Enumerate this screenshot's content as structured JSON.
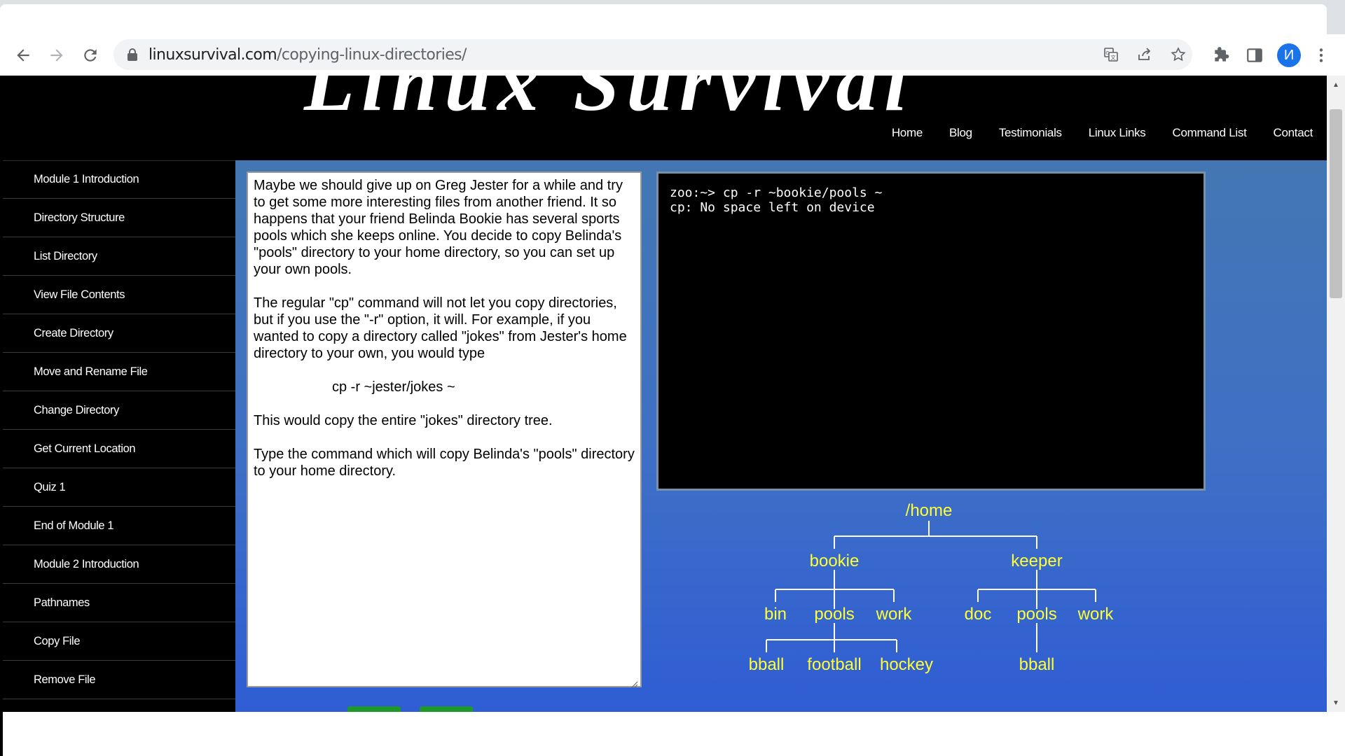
{
  "browser": {
    "url_domain": "linuxsurvival.com",
    "url_path": "/copying-linux-directories/",
    "avatar_letter": "И",
    "accent_color": "#1a73e8"
  },
  "site": {
    "logo_text": "Linux Survival",
    "nav": [
      "Home",
      "Blog",
      "Testimonials",
      "Linux Links",
      "Command List",
      "Contact"
    ]
  },
  "sidebar": {
    "items": [
      "Module 1 Introduction",
      "Directory Structure",
      "List Directory",
      "View File Contents",
      "Create Directory",
      "Move and Rename File",
      "Change Directory",
      "Get Current Location",
      "Quiz 1",
      "End of Module 1",
      "Module 2 Introduction",
      "Pathnames",
      "Copy File",
      "Remove File"
    ]
  },
  "lesson": {
    "p1": "Maybe we should give up on Greg Jester for a while and try to get some more interesting files from another friend. It so happens that your friend Belinda Bookie has several sports pools which she keeps online. You decide to copy Belinda's \"pools\" directory to your home directory, so you can set up your own pools.",
    "p2": "The regular \"cp\" command will not let you copy directories, but if you use the \"-r\" option, it will. For example, if you wanted to copy a directory called \"jokes\" from Jester's home directory to your own, you would type",
    "cmd": "cp -r ~jester/jokes ~",
    "p3": "This would copy the entire \"jokes\" directory tree.",
    "p4": "Type the command which will copy Belinda's \"pools\" directory to your home directory."
  },
  "terminal": {
    "line1": "zoo:~> cp -r ~bookie/pools ~",
    "line2": "cp: No space left on device"
  },
  "tree": {
    "root": "/home",
    "bookie": "bookie",
    "keeper": "keeper",
    "b_bin": "bin",
    "b_pools": "pools",
    "b_work": "work",
    "k_doc": "doc",
    "k_pools": "pools",
    "k_work": "work",
    "bball": "bball",
    "football": "football",
    "hockey": "hockey",
    "k_bball": "bball",
    "node_color": "#ffff33"
  },
  "icons": [
    "back-icon",
    "forward-icon",
    "reload-icon",
    "lock-icon",
    "translate-icon",
    "share-icon",
    "star-icon",
    "extensions-icon",
    "side-panel-icon",
    "menu-icon"
  ]
}
